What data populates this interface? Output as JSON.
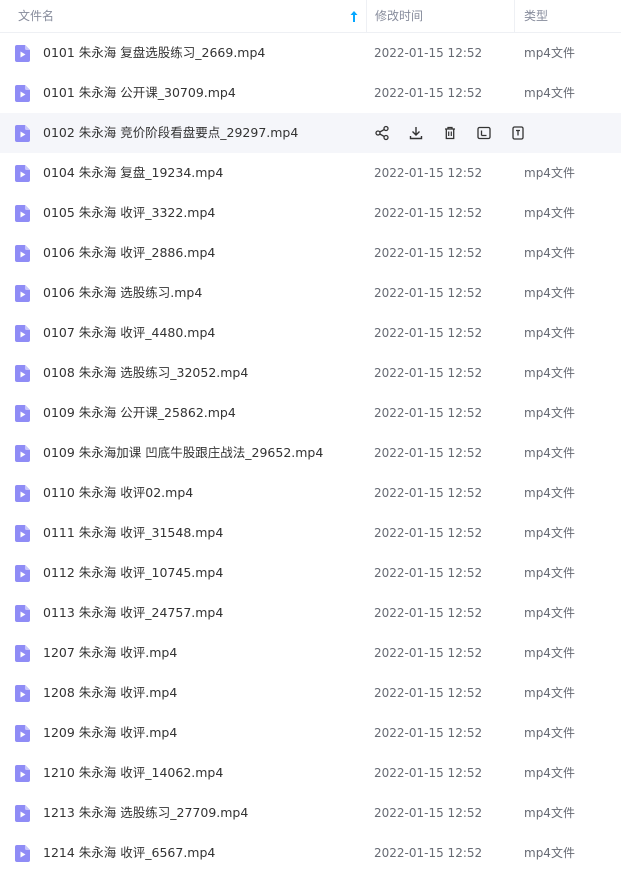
{
  "header": {
    "name_label": "文件名",
    "time_label": "修改时间",
    "type_label": "类型",
    "sort_icon": "arrow-up-icon"
  },
  "files": [
    {
      "name": "0101 朱永海 复盘选股练习_2669.mp4",
      "time": "2022-01-15 12:52",
      "type": "mp4文件"
    },
    {
      "name": "0101 朱永海 公开课_30709.mp4",
      "time": "2022-01-15 12:52",
      "type": "mp4文件"
    },
    {
      "name": "0102 朱永海 竞价阶段看盘要点_29297.mp4",
      "time": "",
      "type": "",
      "hovered": true
    },
    {
      "name": "0104 朱永海 复盘_19234.mp4",
      "time": "2022-01-15 12:52",
      "type": "mp4文件"
    },
    {
      "name": "0105 朱永海 收评_3322.mp4",
      "time": "2022-01-15 12:52",
      "type": "mp4文件"
    },
    {
      "name": "0106 朱永海  收评_2886.mp4",
      "time": "2022-01-15 12:52",
      "type": "mp4文件"
    },
    {
      "name": "0106 朱永海 选股练习.mp4",
      "time": "2022-01-15 12:52",
      "type": "mp4文件"
    },
    {
      "name": "0107 朱永海 收评_4480.mp4",
      "time": "2022-01-15 12:52",
      "type": "mp4文件"
    },
    {
      "name": "0108 朱永海 选股练习_32052.mp4",
      "time": "2022-01-15 12:52",
      "type": "mp4文件"
    },
    {
      "name": "0109 朱永海 公开课_25862.mp4",
      "time": "2022-01-15 12:52",
      "type": "mp4文件"
    },
    {
      "name": "0109 朱永海加课 凹底牛股跟庄战法_29652.mp4",
      "time": "2022-01-15 12:52",
      "type": "mp4文件"
    },
    {
      "name": "0110 朱永海 收评02.mp4",
      "time": "2022-01-15 12:52",
      "type": "mp4文件"
    },
    {
      "name": "0111 朱永海 收评_31548.mp4",
      "time": "2022-01-15 12:52",
      "type": "mp4文件"
    },
    {
      "name": "0112 朱永海 收评_10745.mp4",
      "time": "2022-01-15 12:52",
      "type": "mp4文件"
    },
    {
      "name": "0113 朱永海 收评_24757.mp4",
      "time": "2022-01-15 12:52",
      "type": "mp4文件"
    },
    {
      "name": "1207 朱永海 收评.mp4",
      "time": "2022-01-15 12:52",
      "type": "mp4文件"
    },
    {
      "name": "1208 朱永海 收评.mp4",
      "time": "2022-01-15 12:52",
      "type": "mp4文件"
    },
    {
      "name": "1209 朱永海 收评.mp4",
      "time": "2022-01-15 12:52",
      "type": "mp4文件"
    },
    {
      "name": "1210 朱永海 收评_14062.mp4",
      "time": "2022-01-15 12:52",
      "type": "mp4文件"
    },
    {
      "name": "1213 朱永海 选股练习_27709.mp4",
      "time": "2022-01-15 12:52",
      "type": "mp4文件"
    },
    {
      "name": "1214 朱永海 收评_6567.mp4",
      "time": "2022-01-15 12:52",
      "type": "mp4文件"
    }
  ],
  "hover_actions": [
    "share-icon",
    "download-icon",
    "delete-icon",
    "rename-icon",
    "more-file-icon"
  ],
  "colors": {
    "file_icon": "#8f8cf6",
    "header_text": "#878c9c",
    "sort_arrow": "#06a7ff",
    "hover_bg": "#f5f6fa"
  }
}
